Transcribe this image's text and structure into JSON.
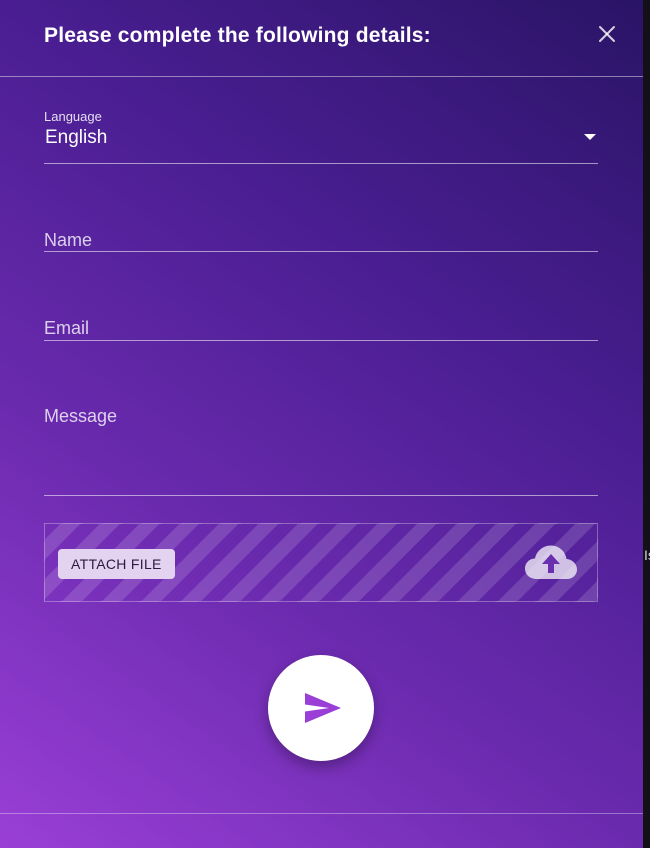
{
  "dialog": {
    "title": "Please complete the following details:",
    "close_icon": "close-icon"
  },
  "language": {
    "label": "Language",
    "value": "English",
    "icon": "caret-down-icon"
  },
  "name": {
    "placeholder": "Name"
  },
  "email": {
    "placeholder": "Email"
  },
  "message": {
    "placeholder": "Message"
  },
  "attachment": {
    "button_label": "ATTACH FILE",
    "icon": "cloud-upload-icon"
  },
  "send": {
    "icon": "send-icon"
  },
  "background_strip": {
    "text": "Is"
  },
  "colors": {
    "gradient_light": "#9a3fd6",
    "gradient_dark": "#2a1466",
    "send_icon": "#9a3fd6",
    "attach_button_bg": "#e3d3f0"
  }
}
